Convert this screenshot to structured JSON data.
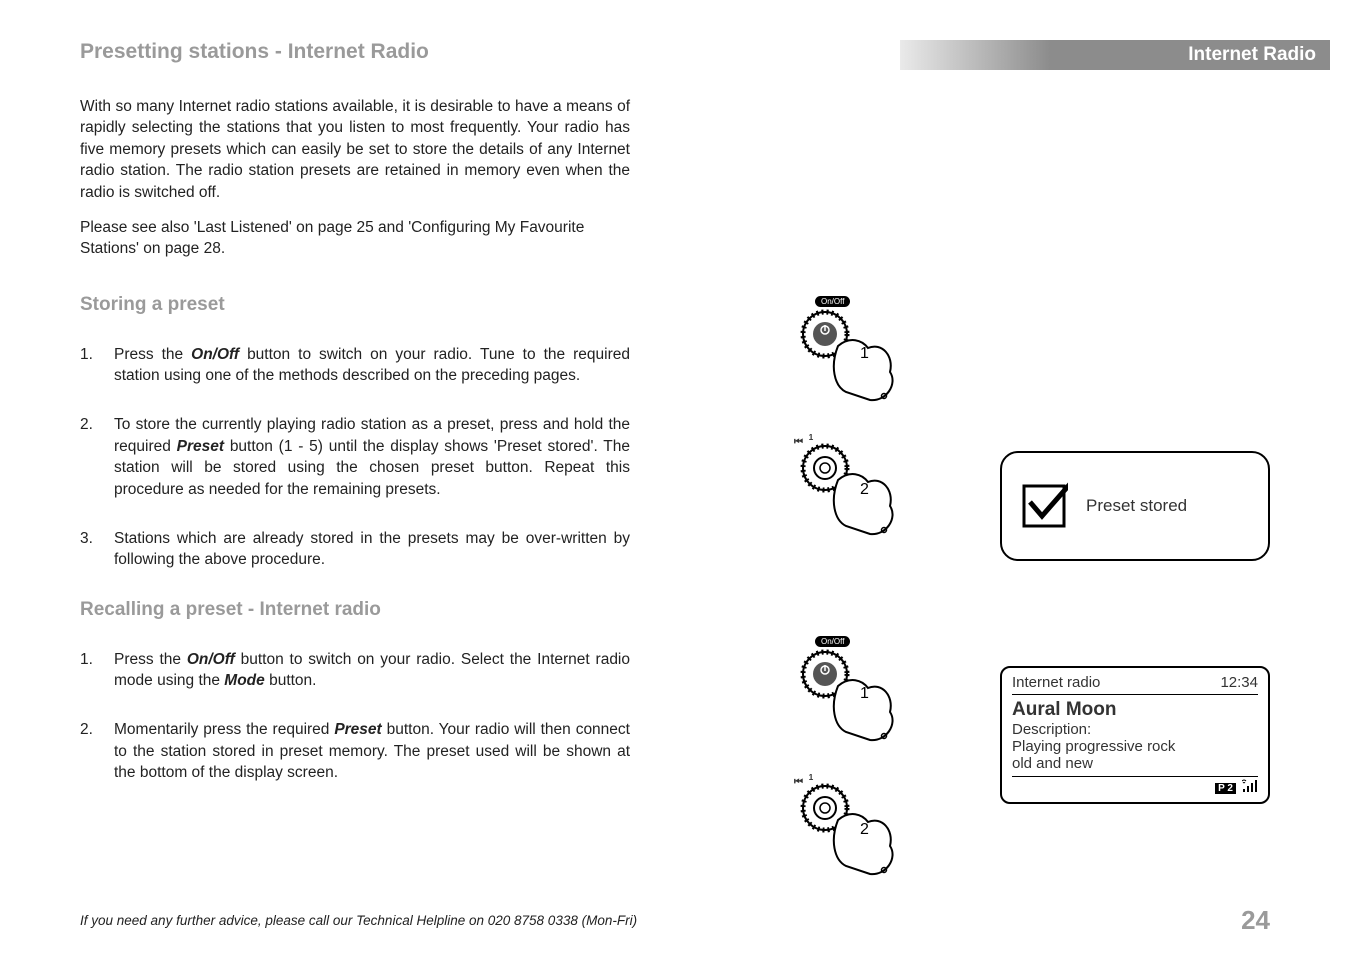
{
  "ribbon": "Internet Radio",
  "h1": "Presetting stations - Internet Radio",
  "intro1": "With so many Internet radio stations available, it is desirable to have a means of rapidly selecting the stations that you listen to most frequently. Your radio has five memory presets which can easily be set to store the details of any Internet radio station. The radio station presets are retained in memory even when the radio is switched off.",
  "intro2": "Please see also 'Last Listened' on page 25 and 'Configuring My Favourite Stations' on page 28.",
  "h2a": "Storing a preset",
  "s1": {
    "num": "1.",
    "a": "Press the ",
    "b": "On/Off",
    "c": " button to switch on your radio. Tune to the required station using one of the methods described on the preceding pages."
  },
  "s2": {
    "num": "2.",
    "a": "To store the currently playing radio station as a preset, press and hold the required ",
    "b": "Preset",
    "c": " button (1 - 5) until the display shows 'Preset stored'. The station will be stored using the chosen preset button. Repeat this procedure as needed for the remaining presets."
  },
  "s3": {
    "num": "3.",
    "txt": "Stations which are already stored in the presets may be over-written by following the above procedure."
  },
  "h2b": "Recalling a preset - Internet radio",
  "r1": {
    "num": "1.",
    "a": "Press the ",
    "b": "On/Off",
    "c": " button to switch on your radio. Select the Internet radio mode using the ",
    "d": "Mode",
    "e": " button."
  },
  "r2": {
    "num": "2.",
    "a": "Momentarily press the required ",
    "b": "Preset",
    "c": " button. Your radio will then connect to the station stored in preset memory. The preset used will be shown at the bottom of the display screen."
  },
  "notice": "Preset stored",
  "screen": {
    "mode": "Internet radio",
    "time": "12:34",
    "station": "Aural Moon",
    "l1": "Description:",
    "l2": "Playing progressive rock",
    "l3": "old and new",
    "badge": "P 2"
  },
  "step_nums": {
    "one": "1",
    "two": "2"
  },
  "button_captions": {
    "onoff": "On/Off",
    "prev_track": "⏮",
    "preset_1": "1"
  },
  "footer": "If you need any further advice, please call our Technical Helpline on 020 8758 0338 (Mon-Fri)",
  "pagenum": "24"
}
